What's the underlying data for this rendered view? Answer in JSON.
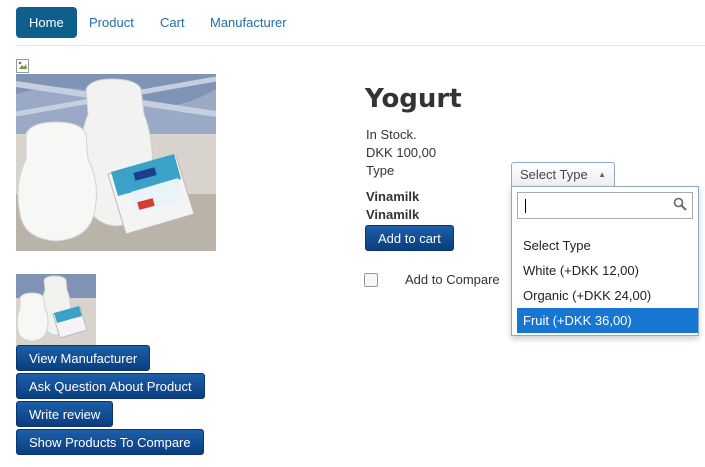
{
  "nav": {
    "items": [
      {
        "label": "Home",
        "active": true
      },
      {
        "label": "Product"
      },
      {
        "label": "Cart"
      },
      {
        "label": "Manufacturer"
      }
    ]
  },
  "product": {
    "title": "Yogurt",
    "stock": "In Stock.",
    "price": "DKK 100,00",
    "type_label": "Type",
    "manufacturer_1": "Vinamilk",
    "manufacturer_2": "Vinamilk",
    "add_to_cart": "Add to cart",
    "add_to_compare": "Add to Compare"
  },
  "type_select": {
    "selected": "Select Type",
    "search_value": "",
    "options": [
      {
        "label": "Select Type"
      },
      {
        "label": "White (+DKK 12,00)"
      },
      {
        "label": "Organic (+DKK 24,00)"
      },
      {
        "label": "Fruit (+DKK 36,00)",
        "highlighted": true
      }
    ]
  },
  "actions": {
    "view_manufacturer": "View Manufacturer",
    "ask_question": "Ask Question About Product",
    "write_review": "Write review",
    "show_compare": "Show Products To Compare"
  },
  "colors": {
    "accent": "#0f5f8c",
    "link": "#1f6fa8",
    "button": "#0b3d80",
    "highlight": "#1776d2"
  }
}
